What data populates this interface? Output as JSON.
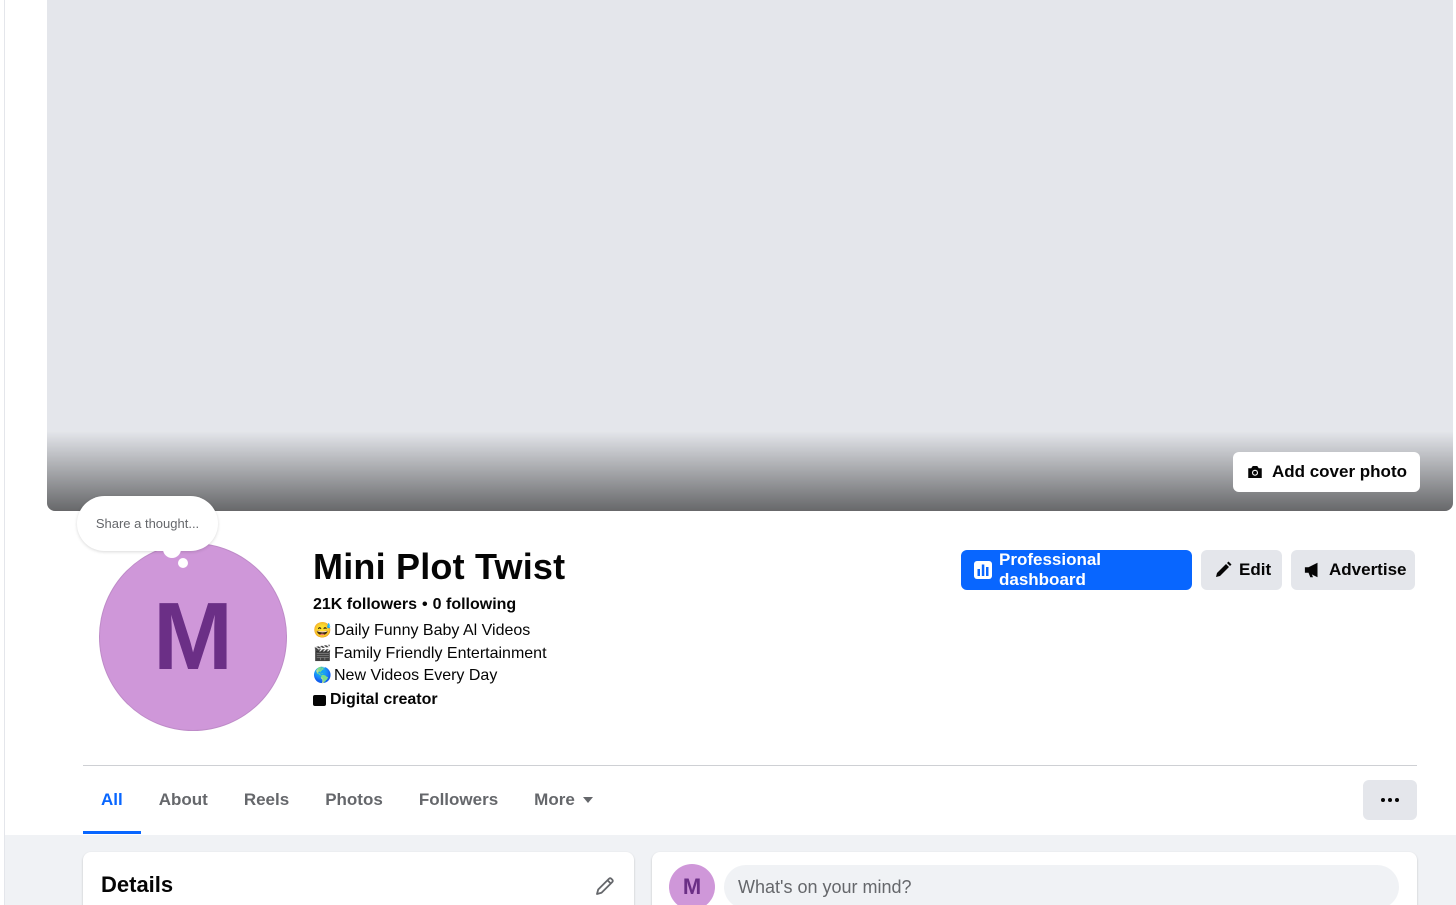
{
  "cover": {
    "add_cover_label": "Add cover photo",
    "camera_icon": "camera-icon"
  },
  "thought_bubble": {
    "placeholder": "Share a thought..."
  },
  "profile": {
    "avatar_letter": "M",
    "name": "Mini Plot Twist",
    "followers": "21K followers",
    "separator": "•",
    "following": "0 following",
    "bio_lines": [
      {
        "emoji": "😅",
        "text": "Daily Funny Baby Al Videos"
      },
      {
        "emoji": "🎬",
        "text": "Family Friendly Entertainment"
      },
      {
        "emoji": "🌎",
        "text": "New Videos Every Day"
      }
    ],
    "category": "Digital creator"
  },
  "actions": {
    "professional_dashboard": "Professional dashboard",
    "edit": "Edit",
    "advertise": "Advertise"
  },
  "tabs": [
    {
      "label": "All",
      "active": true
    },
    {
      "label": "About",
      "active": false
    },
    {
      "label": "Reels",
      "active": false
    },
    {
      "label": "Photos",
      "active": false
    },
    {
      "label": "Followers",
      "active": false
    },
    {
      "label": "More",
      "active": false
    }
  ],
  "details": {
    "title": "Details"
  },
  "composer": {
    "avatar_letter": "M",
    "placeholder": "What's on your mind?"
  },
  "colors": {
    "accent": "#0866ff",
    "avatar_bg": "#cf97d9",
    "avatar_fg": "#6b2f86",
    "button_gray": "#e4e6eb",
    "page_bg": "#f0f2f5"
  }
}
